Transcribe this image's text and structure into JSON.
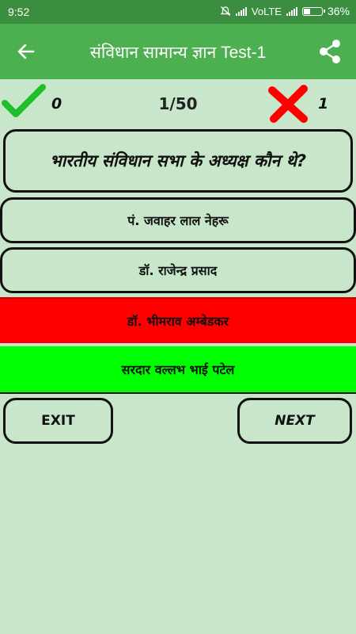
{
  "status_bar": {
    "time": "9:52",
    "network": "VoLTE",
    "battery": "36%",
    "battery_level": 0.36
  },
  "app_bar": {
    "title": "संविधान सामान्य ज्ञान Test-1",
    "back_icon": "arrow-left-icon",
    "share_icon": "share-icon"
  },
  "score": {
    "correct_count": "0",
    "progress": "1/50",
    "wrong_count": "1",
    "correct_icon": "check-icon",
    "wrong_icon": "cross-icon"
  },
  "question": "भारतीय संविधान सभा के अध्यक्ष कौन थे?",
  "options": [
    {
      "label": "पं. जवाहर लाल नेहरू",
      "state": "default"
    },
    {
      "label": "डॉ. राजेन्द्र प्रसाद",
      "state": "default"
    },
    {
      "label": "डॉ. भीमराव अम्बेडकर",
      "state": "wrong"
    },
    {
      "label": "सरदार वल्लभ भाई पटेल",
      "state": "correct"
    }
  ],
  "buttons": {
    "exit": "EXIT",
    "next": "NEXT"
  },
  "colors": {
    "app_bar": "#4caf50",
    "status_bar": "#3b8e3f",
    "background": "#c8e6c9",
    "wrong": "#ff0000",
    "correct": "#00ff00"
  }
}
